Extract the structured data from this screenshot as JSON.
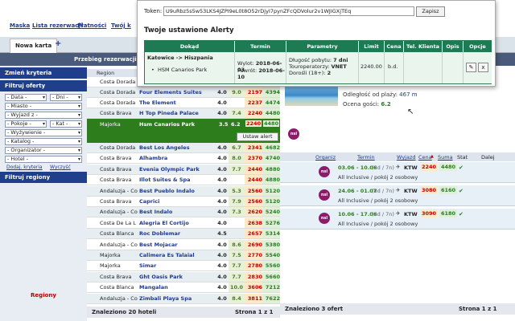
{
  "nav": {
    "links": [
      "Maska",
      "Lista rezerwacji",
      "Płatności",
      "Twój k"
    ]
  },
  "tabs": {
    "new_card": "Nowa karta",
    "add": "+"
  },
  "subbar": {
    "label": "Przebieg rezerwacji:"
  },
  "sidebar": {
    "change_criteria": "Zmień kryteria",
    "filter_offers": "Filtruj oferty",
    "filters": [
      {
        "label": "- Data -",
        "arrow": "▾"
      },
      {
        "label": "- Dni -",
        "arrow": "▾"
      },
      {
        "label": "- Miasto -",
        "arrow": "▾"
      },
      {
        "label": "- Wyjazd z -",
        "arrow": "▾"
      },
      {
        "label": "- Pokoje -",
        "arrow": "▾"
      },
      {
        "label": "- Kat -",
        "arrow": "▾"
      },
      {
        "label": "- Wyżywienie -",
        "arrow": "▾"
      },
      {
        "label": "- Katalog -",
        "arrow": "▾"
      },
      {
        "label": "- Organizator -",
        "arrow": "▾"
      },
      {
        "label": "- Hotel -",
        "arrow": "▾"
      }
    ],
    "add_criteria": "Dodaj. kryteria",
    "clear": "Wyczyść",
    "filter_regions": "Filtruj regiony",
    "regions_label": "Regiony"
  },
  "results": {
    "header_region": "Region",
    "rows_top": [
      {
        "region": "Costa Dorada",
        "hotel": "",
        "stars": "",
        "rating": "",
        "p1": "",
        "p2": ""
      },
      {
        "region": "Costa Dorada",
        "hotel": "Four Elements Suites",
        "stars": "4.0",
        "rating": "9.0",
        "p1": "2197",
        "p2": "4394"
      },
      {
        "region": "Costa Dorada",
        "hotel": "The Element",
        "stars": "4.0",
        "rating": "",
        "p1": "2237",
        "p2": "4474"
      },
      {
        "region": "Costa Brava",
        "hotel": "H Top Pineda Palace",
        "stars": "4.0",
        "rating": "7.4",
        "p1": "2240",
        "p2": "4480"
      }
    ],
    "selected": {
      "region": "Majorka",
      "hotel": "Hsm Canarios Park",
      "stars": "3.5",
      "rating": "6.2",
      "p1": "2240",
      "p2": "4480",
      "button": "Ustaw alert"
    },
    "rows_bottom": [
      {
        "region": "Costa Dorada",
        "hotel": "Best Los Angeles",
        "stars": "4.0",
        "rating": "6.7",
        "p1": "2341",
        "p2": "4682"
      },
      {
        "region": "Costa Brava",
        "hotel": "Alhambra",
        "stars": "4.0",
        "rating": "8.0",
        "p1": "2370",
        "p2": "4740"
      },
      {
        "region": "Costa Brava",
        "hotel": "Evenia Olympic Park",
        "stars": "4.0",
        "rating": "7.7",
        "p1": "2440",
        "p2": "4880"
      },
      {
        "region": "Costa Brava",
        "hotel": "Illot Suites & Spa",
        "stars": "4.0",
        "rating": "",
        "p1": "2440",
        "p2": "4880"
      },
      {
        "region": "Andaluzja - Co",
        "hotel": "Best Pueblo Indalo",
        "stars": "4.0",
        "rating": "5.3",
        "p1": "2560",
        "p2": "5120"
      },
      {
        "region": "Costa Brava",
        "hotel": "Caprici",
        "stars": "4.0",
        "rating": "7.9",
        "p1": "2560",
        "p2": "5120"
      },
      {
        "region": "Andaluzja - Co",
        "hotel": "Best Indalo",
        "stars": "4.0",
        "rating": "7.3",
        "p1": "2620",
        "p2": "5240"
      },
      {
        "region": "Costa De La L",
        "hotel": "Alegria El Cortijo",
        "stars": "4.0",
        "rating": "",
        "p1": "2638",
        "p2": "5276"
      },
      {
        "region": "Costa Blanca",
        "hotel": "Roc Doblemar",
        "stars": "4.5",
        "rating": "",
        "p1": "2657",
        "p2": "5314"
      },
      {
        "region": "Andaluzja - Co",
        "hotel": "Best Mojacar",
        "stars": "4.0",
        "rating": "8.6",
        "p1": "2690",
        "p2": "5380"
      },
      {
        "region": "Majorka",
        "hotel": "Calimera Es Talaial",
        "stars": "4.0",
        "rating": "7.5",
        "p1": "2770",
        "p2": "5540"
      },
      {
        "region": "Majorka",
        "hotel": "Simar",
        "stars": "4.0",
        "rating": "7.7",
        "p1": "2780",
        "p2": "5560"
      },
      {
        "region": "Costa Brava",
        "hotel": "Ght Oasis Park",
        "stars": "4.0",
        "rating": "7.7",
        "p1": "2830",
        "p2": "5660"
      },
      {
        "region": "Costa Blanca",
        "hotel": "Mangalan",
        "stars": "4.0",
        "rating": "10.0",
        "p1": "3606",
        "p2": "7212"
      },
      {
        "region": "Andaluzja - Co",
        "hotel": "Zimbali Playa Spa",
        "stars": "4.0",
        "rating": "8.4",
        "p1": "3811",
        "p2": "7622"
      }
    ],
    "found": "Znaleziono 20 hoteli",
    "page": "Strona 1 z 1"
  },
  "hotel_detail": {
    "distance_label": "Odległość od plaży:",
    "distance_value": "467 m",
    "rating_label": "Ocena gości:",
    "rating_value": "6.2",
    "logo": "nsl"
  },
  "offers": {
    "headers": [
      "Organiz",
      "Termin",
      "Wyjazd",
      "Cena",
      "Suma",
      "Stat",
      "Dalej"
    ],
    "sort_arrow": "▲",
    "rows": [
      {
        "dates": "03.06 - 10.06",
        "nights": "(8d / 7n)",
        "plane": "✈",
        "airport": "KTW",
        "price": "2240",
        "sum": "4480",
        "status": "✔",
        "desc": "All Inclusive / pokój 2 osobowy"
      },
      {
        "dates": "24.06 - 01.07",
        "nights": "(8d / 7n)",
        "plane": "✈",
        "airport": "KTW",
        "price": "3080",
        "sum": "6160",
        "status": "✔",
        "desc": "All Inclusive / pokój 2 osobowy"
      },
      {
        "dates": "10.06 - 17.06",
        "nights": "(8d / 7n)",
        "plane": "✈",
        "airport": "KTW",
        "price": "3090",
        "sum": "6180",
        "status": "✔",
        "desc": "All Inclusive / pokój 2 osobowy"
      }
    ],
    "found": "Znaleziono 3 ofert",
    "page": "Strona 1 z 1"
  },
  "popup": {
    "token_label": "Token:",
    "token_value": "U9uRbz5s5w53LKS4JZPI9eL0t8O52rDjyI7pynZFcQDVolur2v1WJIGXjTEq",
    "save": "Zapisz",
    "title": "Twoje ustawione Alerty",
    "headers": [
      "Dokąd",
      "Termin",
      "Parametry",
      "Limit",
      "Cena",
      "Tel. Klienta",
      "Opis",
      "Opcje"
    ],
    "alert": {
      "route": "Katowice -> Hiszpania",
      "hotel": "HSM Canarios Park",
      "wylot_label": "Wylot:",
      "wylot": "2018-06-03",
      "powrot_label": "Powrót:",
      "powrot": "2018-06-10",
      "dlugosc_label": "Długość pobytu:",
      "dlugosc": "7 dni",
      "tour_label": "Touroperatorzy:",
      "tour": "VNET",
      "dorosli_label": "Dorośli (18+):",
      "dorosli": "2",
      "limit": "2240.00",
      "cena": "b.d.",
      "tel": "",
      "opis": "",
      "edit": "✎",
      "delete": "x"
    }
  },
  "colors": {
    "nav_blue": "#1f3f8c",
    "selected_green": "#2e7d1c",
    "popup_green": "#1e7a52",
    "price_red": "#b00000",
    "sum_green": "#2a7a2a"
  }
}
